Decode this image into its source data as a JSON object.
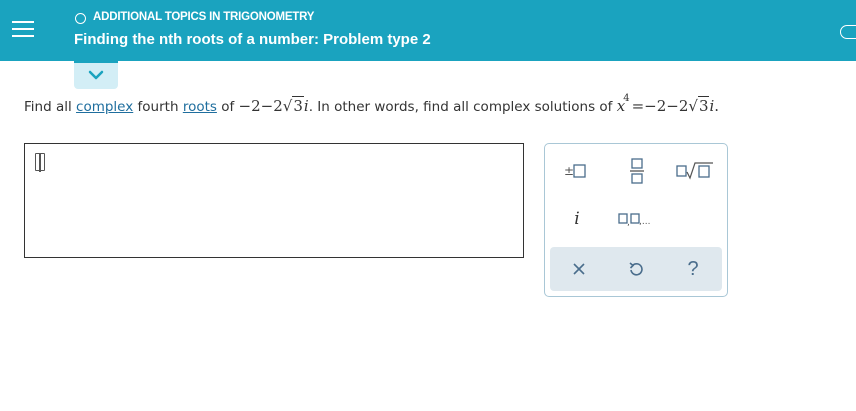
{
  "header": {
    "topic": "ADDITIONAL TOPICS IN TRIGONOMETRY",
    "title": "Finding the nth roots of a number: Problem type 2"
  },
  "question": {
    "prefix": "Find all",
    "link_complex": "complex",
    "middle1": "fourth",
    "link_roots": "roots",
    "middle2": "of",
    "number_part": "−2−2",
    "radicand": "3",
    "imag": "i",
    "sentence2": ". In other words, find all complex solutions of",
    "var": "x",
    "exponent": "4",
    "equals": "=−2−2",
    "radicand2": "3",
    "imag2": "i",
    "end": "."
  },
  "answer": {
    "value": ""
  },
  "toolbar": {
    "buttons": [
      "plus-minus",
      "fraction",
      "nth-root",
      "imaginary-i",
      "list"
    ],
    "i_label": "i",
    "help_label": "?",
    "list_label": "□,□,..."
  },
  "colors": {
    "header": "#1aa3bf",
    "link": "#1f6e9e"
  }
}
